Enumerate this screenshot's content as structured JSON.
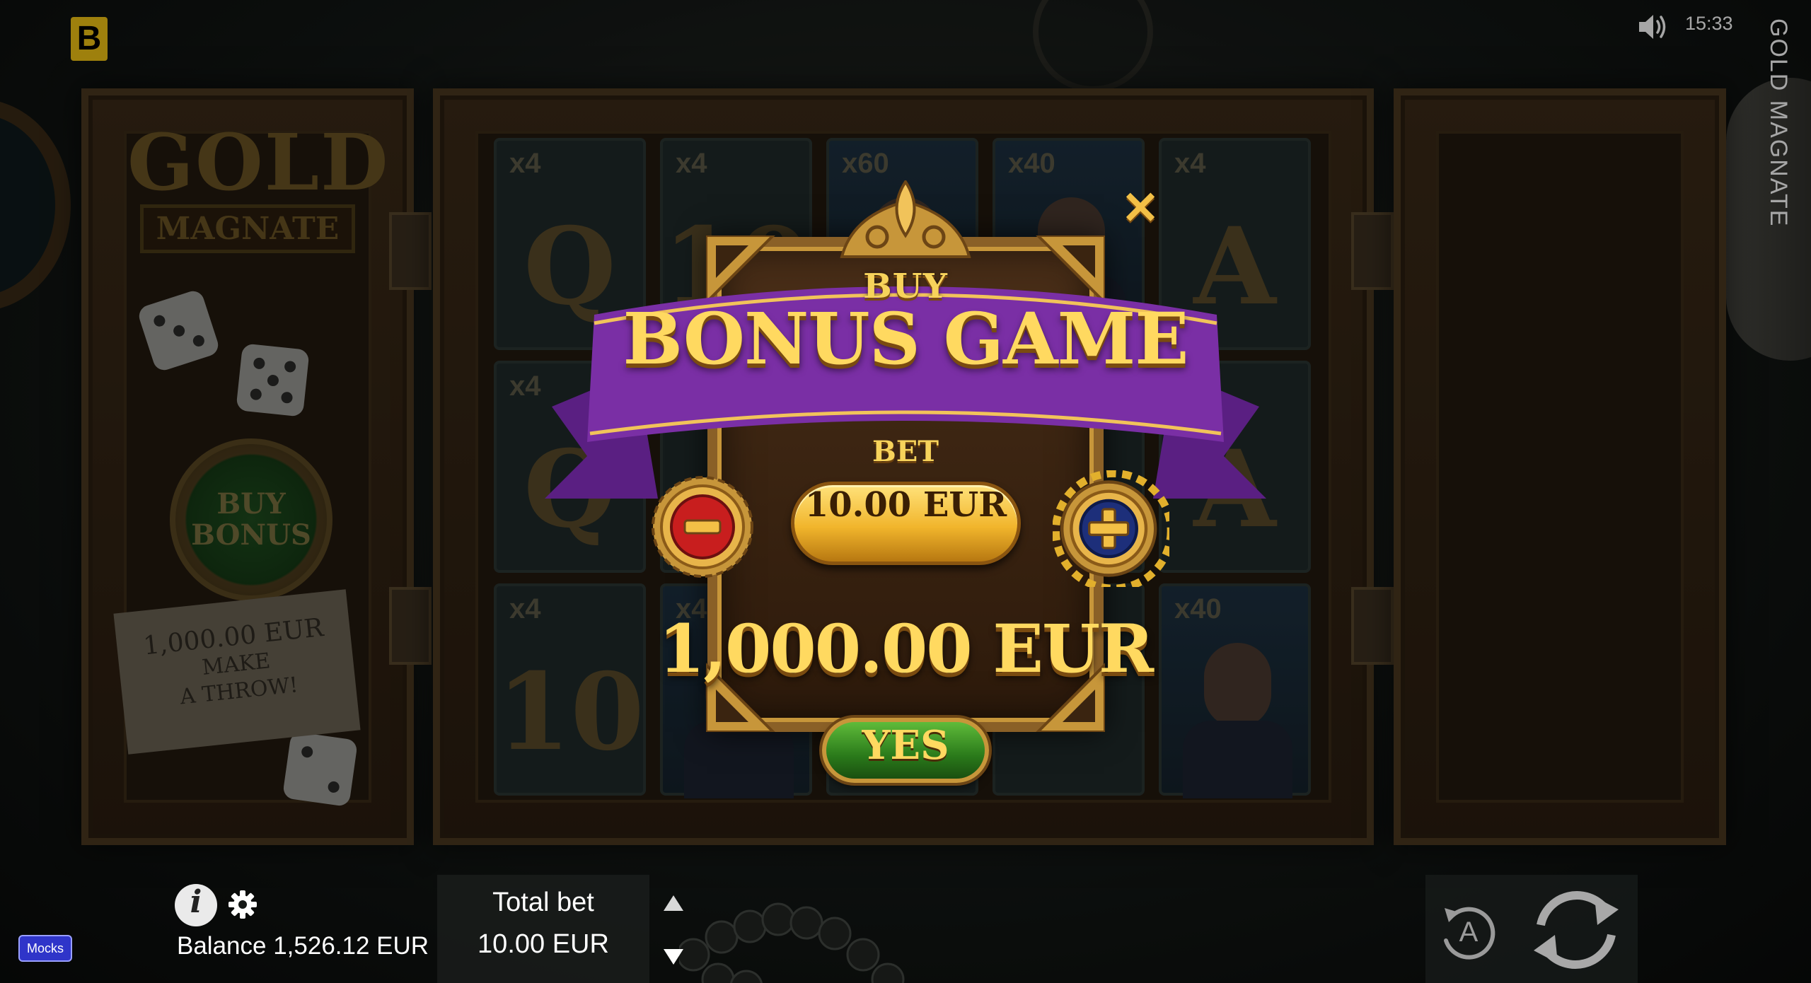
{
  "app": {
    "brand_letter": "B",
    "game_title": "GOLD MAGNATE"
  },
  "status_bar": {
    "time": "15:33",
    "sound_icon": "speaker-on-icon"
  },
  "background": {
    "logo": {
      "line1": "GOLD",
      "line2": "MAGNATE"
    },
    "buy_bonus_button": "BUY BONUS",
    "note": {
      "amount": "1,000.00 EUR",
      "line1": "MAKE",
      "line2": "A THROW!"
    },
    "reels": [
      {
        "mult": "x4",
        "sym": "Q"
      },
      {
        "mult": "x4",
        "sym": "10"
      },
      {
        "mult": "x60",
        "sym": ""
      },
      {
        "mult": "x40",
        "sym": ""
      },
      {
        "mult": "x4",
        "sym": "A"
      },
      {
        "mult": "x4",
        "sym": "Q"
      },
      {
        "mult": "",
        "sym": ""
      },
      {
        "mult": "",
        "sym": ""
      },
      {
        "mult": "",
        "sym": ""
      },
      {
        "mult": "",
        "sym": "A"
      },
      {
        "mult": "x4",
        "sym": "10"
      },
      {
        "mult": "x4",
        "sym": ""
      },
      {
        "mult": "",
        "sym": ""
      },
      {
        "mult": "",
        "sym": ""
      },
      {
        "mult": "x40",
        "sym": ""
      }
    ]
  },
  "modal": {
    "title_small": "BUY",
    "title_main": "BONUS GAME",
    "bet_label": "BET",
    "bet_value": "10.00 EUR",
    "price": "1,000.00 EUR",
    "confirm_label": "YES",
    "close_icon": "close-icon",
    "minus_icon": "minus-icon",
    "plus_icon": "plus-icon"
  },
  "bottom_bar": {
    "balance": "Balance 1,526.12 EUR",
    "total_bet_label": "Total bet",
    "total_bet_value": "10.00 EUR",
    "mocks_badge": "Mocks",
    "autoplay_label": "A"
  },
  "colors": {
    "accent_gold": "#ffd960",
    "ribbon_purple": "#7a2fa5",
    "confirm_green": "#2a7a1a",
    "brand_yellow": "#f3c515"
  }
}
